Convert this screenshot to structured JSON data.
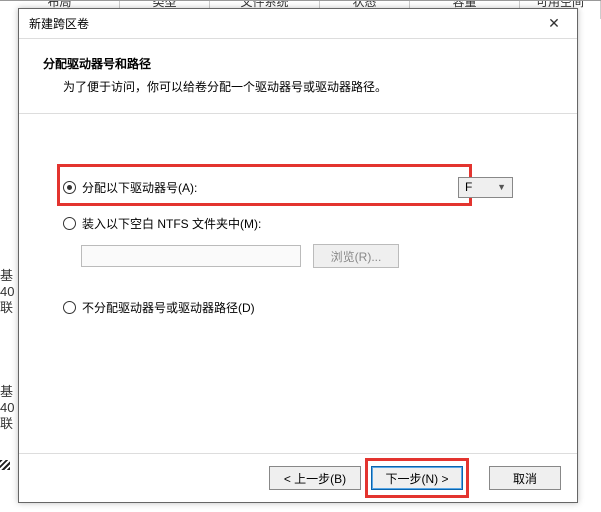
{
  "bg": {
    "headers": [
      "布局",
      "类型",
      "文件系统",
      "状态",
      "容量",
      "可用空间"
    ],
    "side1": "基\n40\n联",
    "side2": "基\n40\n联"
  },
  "dialog": {
    "title": "新建跨区卷",
    "close_glyph": "✕",
    "heading": "分配驱动器号和路径",
    "subheading": "为了便于访问，你可以给卷分配一个驱动器号或驱动器路径。",
    "opt_assign": "分配以下驱动器号(A):",
    "drive_letter": "F",
    "opt_mount": "装入以下空白 NTFS 文件夹中(M):",
    "browse_label": "浏览(R)...",
    "opt_none": "不分配驱动器号或驱动器路径(D)",
    "back_label": "< 上一步(B)",
    "next_label": "下一步(N) >",
    "cancel_label": "取消"
  }
}
